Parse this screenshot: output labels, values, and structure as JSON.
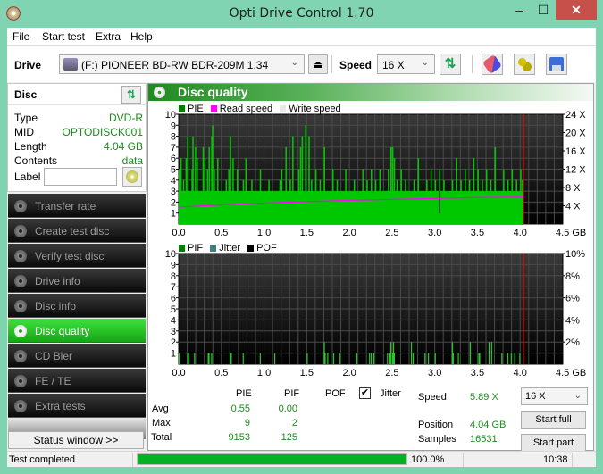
{
  "window": {
    "title": "Opti Drive Control 1.70",
    "minimize": "‒",
    "maximize": "☐",
    "close": "✕"
  },
  "menu": [
    "File",
    "Start test",
    "Extra",
    "Help"
  ],
  "toolbar": {
    "drive_label": "Drive",
    "drive_value": "(F:)  PIONEER BD-RW   BDR-209M 1.34",
    "speed_label": "Speed",
    "speed_value": "16 X",
    "eject_glyph": "⏏",
    "refresh_glyph": "⇅",
    "chevron": "⌄"
  },
  "disc": {
    "header": "Disc",
    "refresh_glyph": "⇅",
    "rows": [
      {
        "key": "Type",
        "value": "DVD-R"
      },
      {
        "key": "MID",
        "value": "OPTODISCK001"
      },
      {
        "key": "Length",
        "value": "4.04 GB"
      },
      {
        "key": "Contents",
        "value": "data"
      }
    ],
    "label_key": "Label",
    "label_value": ""
  },
  "nav": [
    {
      "label": "Transfer rate",
      "active": false
    },
    {
      "label": "Create test disc",
      "active": false
    },
    {
      "label": "Verify test disc",
      "active": false
    },
    {
      "label": "Drive info",
      "active": false
    },
    {
      "label": "Disc info",
      "active": false
    },
    {
      "label": "Disc quality",
      "active": true
    },
    {
      "label": "CD Bler",
      "active": false
    },
    {
      "label": "FE / TE",
      "active": false
    },
    {
      "label": "Extra tests",
      "active": false
    }
  ],
  "status_window_label": "Status window >>",
  "main": {
    "title": "Disc quality"
  },
  "colors": {
    "pie": "#00c800",
    "read_speed": "#ff00ff",
    "write_speed": "#e8e8e8",
    "jitter": "#408080",
    "pof": "#000000",
    "marker": "#ff0000",
    "accent_green": "#1b8a1b"
  },
  "chart_data": [
    {
      "type": "bar",
      "title": "PIE / Read speed",
      "legend": [
        "PIE",
        "Read speed",
        "Write speed"
      ],
      "legend_placement": "top-left",
      "xlabel": "GB",
      "x_ticks": [
        "0.0",
        "0.5",
        "1.0",
        "1.5",
        "2.0",
        "2.5",
        "3.0",
        "3.5",
        "4.0",
        "4.5 GB"
      ],
      "xlim": [
        0,
        4.5
      ],
      "y_ticks": [
        "1",
        "2",
        "3",
        "4",
        "5",
        "6",
        "7",
        "8",
        "9",
        "10"
      ],
      "ylim": [
        0,
        10
      ],
      "y2_ticks": [
        "4 X",
        "8 X",
        "12 X",
        "16 X",
        "20 X",
        "24 X"
      ],
      "y2lim": [
        0,
        24
      ],
      "grid": true,
      "end_marker_gb": 4.04,
      "pie_baseline": 2,
      "pie_spikes": [
        [
          0.0,
          5
        ],
        [
          0.02,
          6
        ],
        [
          0.05,
          4
        ],
        [
          0.08,
          6
        ],
        [
          0.1,
          5
        ],
        [
          0.1,
          8
        ],
        [
          0.15,
          5
        ],
        [
          0.16,
          8
        ],
        [
          0.19,
          7
        ],
        [
          0.21,
          6
        ],
        [
          0.25,
          3
        ],
        [
          0.28,
          7
        ],
        [
          0.3,
          6
        ],
        [
          0.33,
          5
        ],
        [
          0.35,
          7
        ],
        [
          0.38,
          8
        ],
        [
          0.39,
          9
        ],
        [
          0.41,
          5
        ],
        [
          0.45,
          6
        ],
        [
          0.5,
          3
        ],
        [
          0.55,
          4
        ],
        [
          0.58,
          5
        ],
        [
          0.6,
          8
        ],
        [
          0.63,
          6
        ],
        [
          0.68,
          5
        ],
        [
          0.75,
          4
        ],
        [
          0.78,
          6
        ],
        [
          0.85,
          4
        ],
        [
          0.9,
          3
        ],
        [
          0.95,
          5
        ],
        [
          1.0,
          3
        ],
        [
          1.05,
          4
        ],
        [
          1.1,
          3
        ],
        [
          1.18,
          4
        ],
        [
          1.2,
          5
        ],
        [
          1.25,
          7
        ],
        [
          1.3,
          4
        ],
        [
          1.33,
          8
        ],
        [
          1.4,
          5
        ],
        [
          1.42,
          7
        ],
        [
          1.44,
          8
        ],
        [
          1.48,
          9
        ],
        [
          1.52,
          8
        ],
        [
          1.55,
          4
        ],
        [
          1.6,
          5
        ],
        [
          1.65,
          4
        ],
        [
          1.7,
          7
        ],
        [
          1.75,
          3
        ],
        [
          1.8,
          5
        ],
        [
          1.85,
          4
        ],
        [
          1.9,
          3
        ],
        [
          1.95,
          5
        ],
        [
          2.0,
          3
        ],
        [
          2.05,
          4
        ],
        [
          2.1,
          3
        ],
        [
          2.15,
          5
        ],
        [
          2.2,
          4
        ],
        [
          2.25,
          5
        ],
        [
          2.3,
          4
        ],
        [
          2.35,
          5
        ],
        [
          2.4,
          3
        ],
        [
          2.45,
          5
        ],
        [
          2.48,
          7
        ],
        [
          2.5,
          7
        ],
        [
          2.52,
          6
        ],
        [
          2.55,
          4
        ],
        [
          2.6,
          5
        ],
        [
          2.65,
          4
        ],
        [
          2.7,
          3
        ],
        [
          2.75,
          4
        ],
        [
          2.8,
          6
        ],
        [
          2.85,
          3
        ],
        [
          2.9,
          4
        ],
        [
          2.95,
          5
        ],
        [
          3.0,
          4
        ],
        [
          3.05,
          5
        ],
        [
          3.1,
          4
        ],
        [
          3.15,
          3
        ],
        [
          3.2,
          4
        ],
        [
          3.25,
          6
        ],
        [
          3.3,
          4
        ],
        [
          3.35,
          5
        ],
        [
          3.4,
          4
        ],
        [
          3.45,
          6
        ],
        [
          3.5,
          5
        ],
        [
          3.55,
          4
        ],
        [
          3.6,
          5
        ],
        [
          3.65,
          4
        ],
        [
          3.7,
          7
        ],
        [
          3.75,
          3
        ],
        [
          3.8,
          5
        ],
        [
          3.85,
          4
        ],
        [
          3.9,
          5
        ],
        [
          3.95,
          4
        ],
        [
          4.0,
          5
        ],
        [
          4.02,
          4
        ]
      ],
      "pie_dips": [
        [
          3.05,
          1
        ]
      ],
      "read_speed_x": [
        0.0,
        0.5,
        1.0,
        1.5,
        2.0,
        2.5,
        3.0,
        3.5,
        4.04
      ],
      "read_speed_y": [
        3.7,
        4.2,
        4.6,
        4.9,
        5.2,
        5.4,
        5.6,
        5.8,
        5.9
      ]
    },
    {
      "type": "bar",
      "title": "PIF / Jitter",
      "legend": [
        "PIF",
        "Jitter",
        "POF"
      ],
      "legend_placement": "top-left",
      "xlabel": "GB",
      "x_ticks": [
        "0.0",
        "0.5",
        "1.0",
        "1.5",
        "2.0",
        "2.5",
        "3.0",
        "3.5",
        "4.0",
        "4.5 GB"
      ],
      "xlim": [
        0,
        4.5
      ],
      "y_ticks": [
        "1",
        "2",
        "3",
        "4",
        "5",
        "6",
        "7",
        "8",
        "9",
        "10"
      ],
      "ylim": [
        0,
        10
      ],
      "y2_ticks": [
        "2%",
        "4%",
        "6%",
        "8%",
        "10%"
      ],
      "y2lim": [
        0,
        10
      ],
      "grid": true,
      "end_marker_gb": 4.04,
      "pif_x": [
        0.0,
        0.1,
        0.11,
        0.18,
        0.34,
        0.35,
        0.38,
        0.6,
        0.61,
        0.75,
        0.95,
        1.12,
        1.5,
        1.7,
        1.71,
        1.74,
        1.81,
        1.88,
        2.08,
        2.23,
        2.25,
        2.28,
        2.44,
        2.47,
        2.48,
        2.5,
        2.51,
        2.52,
        2.72,
        2.74,
        2.88,
        2.92,
        3.0,
        3.2,
        3.21,
        3.27,
        3.41,
        3.51,
        3.52,
        3.63,
        3.66,
        3.78,
        3.85,
        3.89,
        3.93,
        3.99,
        4.03
      ],
      "pif_y": [
        1,
        1,
        1,
        1,
        1,
        1,
        1,
        1,
        1,
        1,
        1,
        1,
        1,
        2,
        1,
        1,
        1,
        1,
        1,
        1,
        1,
        1,
        1,
        1,
        2,
        1,
        2,
        1,
        2,
        1,
        1,
        1,
        1,
        2,
        1,
        1,
        2,
        1,
        1,
        2,
        2,
        1,
        1,
        1,
        1,
        1,
        1
      ]
    }
  ],
  "stats": {
    "col_pie": "PIE",
    "col_pif": "PIF",
    "col_pof": "POF",
    "jitter_label": "Jitter",
    "jitter_checked": "✔",
    "row_avg": "Avg",
    "row_max": "Max",
    "row_total": "Total",
    "avg_pie": "0.55",
    "avg_pif": "0.00",
    "max_pie": "9",
    "max_pif": "2",
    "total_pie": "9153",
    "total_pif": "125",
    "speed_label": "Speed",
    "speed_value": "5.89 X",
    "position_label": "Position",
    "position_value": "4.04 GB",
    "samples_label": "Samples",
    "samples_value": "16531",
    "test_speed": "16 X",
    "start_full": "Start full",
    "start_part": "Start part"
  },
  "statusbar": {
    "text": "Test completed",
    "progress": 1.0,
    "progress_text": "100.0%",
    "time": "10:38"
  }
}
